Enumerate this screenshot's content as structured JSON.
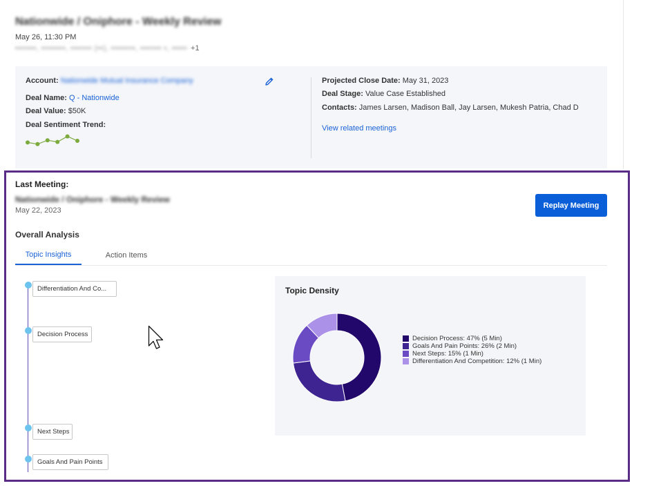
{
  "header": {
    "title": "Nationwide / Oniphore - Weekly Review",
    "datetime": "May 26, 11:30 PM",
    "participants_redacted": "▪▪▪▪▪▪▪, ▪▪▪▪▪▪▪▪, ▪▪▪▪▪▪▪ (▪▪), ▪▪▪▪▪▪▪▪, ▪▪▪▪▪▪▪ ▪, ▪▪▪▪▪",
    "participants_more": "+1"
  },
  "deal": {
    "account_label": "Account:",
    "account_value": "Nationwide Mutual Insurance Company",
    "deal_name_label": "Deal Name:",
    "deal_name_value": "Q - Nationwide",
    "deal_value_label": "Deal Value:",
    "deal_value_value": "$50K",
    "sentiment_label": "Deal Sentiment Trend:",
    "sentiment_trend": [
      0.35,
      0.2,
      0.55,
      0.4,
      0.9,
      0.5
    ],
    "projected_close_label": "Projected Close Date:",
    "projected_close_value": "May 31, 2023",
    "deal_stage_label": "Deal Stage:",
    "deal_stage_value": "Value Case Established",
    "contacts_label": "Contacts:",
    "contacts_value": "James Larsen, Madison Ball, Jay Larsen, Mukesh Patria, Chad D",
    "view_related": "View related meetings"
  },
  "last_meeting": {
    "label": "Last Meeting:",
    "name": "Nationwide / Oniphore - Weekly Review",
    "date": "May 22, 2023",
    "replay_button": "Replay Meeting"
  },
  "analysis": {
    "title": "Overall Analysis",
    "tabs": [
      {
        "label": "Topic Insights",
        "active": true
      },
      {
        "label": "Action Items",
        "active": false
      }
    ]
  },
  "timeline": [
    {
      "label": "Differentiation And Co..."
    },
    {
      "label": "Decision Process"
    },
    {
      "label": "Next Steps"
    },
    {
      "label": "Goals And Pain Points"
    }
  ],
  "density": {
    "title": "Topic Density"
  },
  "chart_data": {
    "type": "pie",
    "title": "Topic Density",
    "categories": [
      "Decision Process",
      "Goals And Pain Points",
      "Next Steps",
      "Differentiation And Competition"
    ],
    "values": [
      47,
      26,
      15,
      12
    ],
    "legend": [
      "Decision Process: 47% (5 Min)",
      "Goals And Pain Points: 26% (2 Min)",
      "Next Steps: 15% (1 Min)",
      "Differentiation And Competition: 12% (1 Min)"
    ],
    "colors": [
      "#23086b",
      "#3d2490",
      "#6a4bc4",
      "#ab92e8"
    ],
    "legend_position": "right"
  },
  "colors": {
    "link": "#1a62d6",
    "primary_button": "#0a5fd8",
    "highlight_border": "#5b2c86",
    "sparkline": "#7caa3c",
    "timeline_dot": "#6cc4ee"
  },
  "icons": {
    "edit": "pencil-icon",
    "cursor": "mouse-pointer-icon"
  }
}
